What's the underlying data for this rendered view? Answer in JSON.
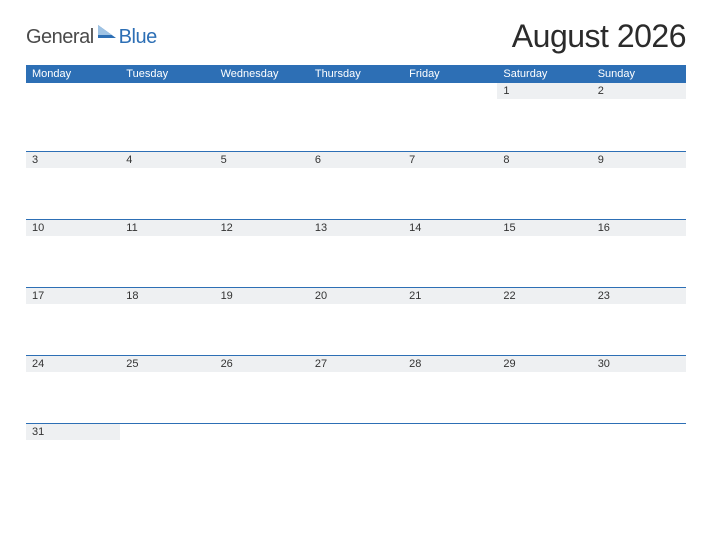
{
  "logo": {
    "word1": "General",
    "word2": "Blue"
  },
  "title": "August 2026",
  "days": [
    "Monday",
    "Tuesday",
    "Wednesday",
    "Thursday",
    "Friday",
    "Saturday",
    "Sunday"
  ],
  "weeks": [
    [
      "",
      "",
      "",
      "",
      "",
      "1",
      "2"
    ],
    [
      "3",
      "4",
      "5",
      "6",
      "7",
      "8",
      "9"
    ],
    [
      "10",
      "11",
      "12",
      "13",
      "14",
      "15",
      "16"
    ],
    [
      "17",
      "18",
      "19",
      "20",
      "21",
      "22",
      "23"
    ],
    [
      "24",
      "25",
      "26",
      "27",
      "28",
      "29",
      "30"
    ],
    [
      "31",
      "",
      "",
      "",
      "",
      "",
      ""
    ]
  ]
}
